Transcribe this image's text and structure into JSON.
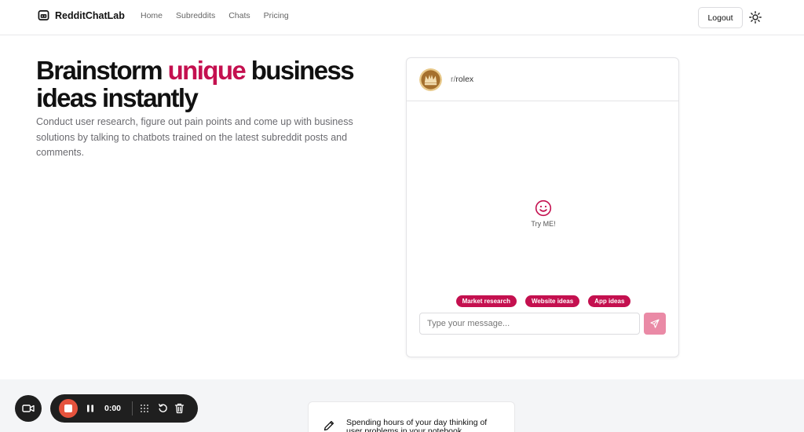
{
  "app": {
    "name": "RedditChatLab"
  },
  "nav": {
    "items": [
      "Home",
      "Subreddits",
      "Chats",
      "Pricing"
    ]
  },
  "header": {
    "logout_label": "Logout"
  },
  "hero": {
    "title_before": "Brainstorm ",
    "title_accent": "unique",
    "title_after": " business ideas instantly",
    "subtitle": "Conduct user research, figure out pain points and come up with business solutions by talking to chatbots trained on the latest subreddit posts and comments."
  },
  "chat": {
    "subreddit_prefix": "r/",
    "subreddit_name": "rolex",
    "empty_label": "Try ME!",
    "chips": [
      "Market research",
      "Website ideas",
      "App ideas"
    ],
    "input_placeholder": "Type your message...",
    "input_value": ""
  },
  "feature": {
    "text": "Spending hours of your day thinking of user problems in your notebook"
  },
  "recorder": {
    "timer": "0:00"
  },
  "colors": {
    "accent": "#c4104f",
    "send_button": "#ea8aa6",
    "record": "#e5533d"
  }
}
